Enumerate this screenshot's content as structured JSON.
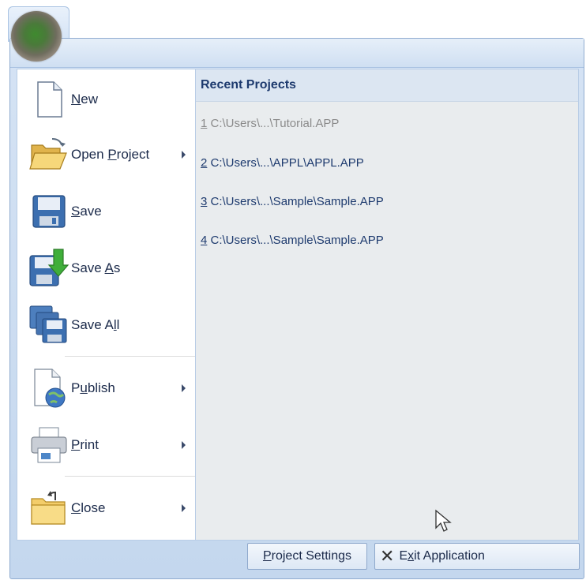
{
  "menu": {
    "commands": [
      {
        "label_pre": "",
        "mnemonic": "N",
        "label_post": "ew",
        "icon": "new-document-icon",
        "submenu": false
      },
      {
        "label_pre": "Open ",
        "mnemonic": "P",
        "label_post": "roject",
        "icon": "open-folder-icon",
        "submenu": true
      },
      {
        "label_pre": "",
        "mnemonic": "S",
        "label_post": "ave",
        "icon": "save-icon",
        "submenu": false
      },
      {
        "label_pre": "Save ",
        "mnemonic": "A",
        "label_post": "s",
        "icon": "save-as-icon",
        "submenu": false
      },
      {
        "label_pre": "Save A",
        "mnemonic": "l",
        "label_post": "l",
        "icon": "save-all-icon",
        "submenu": false
      },
      {
        "label_pre": "P",
        "mnemonic": "u",
        "label_post": "blish",
        "icon": "publish-globe-icon",
        "submenu": true
      },
      {
        "label_pre": "",
        "mnemonic": "P",
        "label_post": "rint",
        "icon": "printer-icon",
        "submenu": true
      },
      {
        "label_pre": "",
        "mnemonic": "C",
        "label_post": "lose",
        "icon": "close-folder-icon",
        "submenu": true
      }
    ]
  },
  "recent": {
    "header": "Recent Projects",
    "items": [
      {
        "num": "1",
        "path": " C:\\Users\\...\\Tutorial.APP"
      },
      {
        "num": "2",
        "path": " C:\\Users\\...\\APPL\\APPL.APP"
      },
      {
        "num": "3",
        "path": " C:\\Users\\...\\Sample\\Sample.APP"
      },
      {
        "num": "4",
        "path": " C:\\Users\\...\\Sample\\Sample.APP"
      }
    ]
  },
  "footer": {
    "settings_mn": "P",
    "settings_rest": "roject Settings",
    "exit_pre": "E",
    "exit_mn": "x",
    "exit_post": "it Application"
  },
  "colors": {
    "accent": "#1d3a6e",
    "frame": "#c4d7ee",
    "dim_text": "#8a8a8a"
  }
}
